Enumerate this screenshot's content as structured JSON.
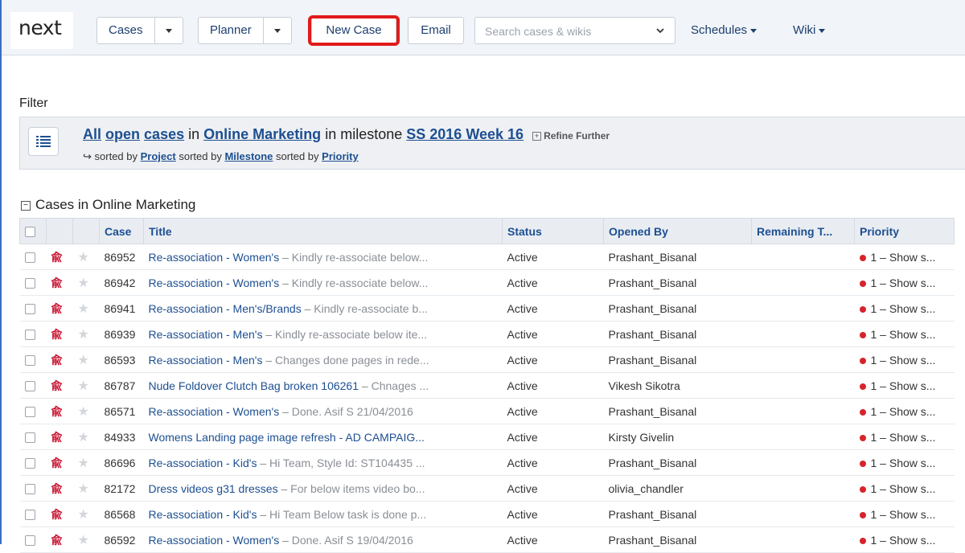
{
  "nav": {
    "logo": "next",
    "cases_label": "Cases",
    "planner_label": "Planner",
    "new_case_label": "New Case",
    "email_label": "Email",
    "search_placeholder": "Search cases & wikis",
    "schedules_label": "Schedules",
    "wiki_label": "Wiki",
    "highlight_color": "#e01b1b"
  },
  "filter": {
    "label": "Filter",
    "all": "All",
    "open": "open",
    "cases": "cases",
    "in1": "in",
    "project": "Online Marketing",
    "in_milestone": "in milestone",
    "milestone": "SS 2016 Week 16",
    "refine": "Refine Further",
    "sorted_arrow": "↪",
    "sorted_by_1": "sorted by",
    "sort1": "Project",
    "sorted_by_2": "sorted by",
    "sort2": "Milestone",
    "sorted_by_3": "sorted by",
    "sort3": "Priority"
  },
  "group": {
    "title": "Cases in Online Marketing"
  },
  "table": {
    "headers": {
      "case": "Case",
      "title": "Title",
      "status": "Status",
      "opened_by": "Opened By",
      "remaining": "Remaining T...",
      "priority": "Priority"
    },
    "rows": [
      {
        "case": "86952",
        "title": "Re-association - Women's",
        "excerpt": "Kindly re-associate below...",
        "status": "Active",
        "opened_by": "Prashant_Bisanal",
        "priority": "1 – Show s..."
      },
      {
        "case": "86942",
        "title": "Re-association - Women's",
        "excerpt": "Kindly re-associate below...",
        "status": "Active",
        "opened_by": "Prashant_Bisanal",
        "priority": "1 – Show s..."
      },
      {
        "case": "86941",
        "title": "Re-association - Men's/Brands",
        "excerpt": "Kindly re-associate b...",
        "status": "Active",
        "opened_by": "Prashant_Bisanal",
        "priority": "1 – Show s..."
      },
      {
        "case": "86939",
        "title": "Re-association - Men's",
        "excerpt": "Kindly re-associate below ite...",
        "status": "Active",
        "opened_by": "Prashant_Bisanal",
        "priority": "1 – Show s..."
      },
      {
        "case": "86593",
        "title": "Re-association - Men's",
        "excerpt": "Changes done pages in rede...",
        "status": "Active",
        "opened_by": "Prashant_Bisanal",
        "priority": "1 – Show s..."
      },
      {
        "case": "86787",
        "title": "Nude Foldover Clutch Bag broken 106261",
        "excerpt": "Chnages ...",
        "status": "Active",
        "opened_by": "Vikesh Sikotra",
        "priority": "1 – Show s..."
      },
      {
        "case": "86571",
        "title": "Re-association - Women's",
        "excerpt": "Done. Asif S 21/04/2016",
        "status": "Active",
        "opened_by": "Prashant_Bisanal",
        "priority": "1 – Show s..."
      },
      {
        "case": "84933",
        "title": "Womens Landing page image refresh - AD CAMPAIG...",
        "excerpt": "",
        "status": "Active",
        "opened_by": "Kirsty Givelin",
        "priority": "1 – Show s..."
      },
      {
        "case": "86696",
        "title": "Re-association - Kid's",
        "excerpt": "Hi Team, Style Id: ST104435 ...",
        "status": "Active",
        "opened_by": "Prashant_Bisanal",
        "priority": "1 – Show s..."
      },
      {
        "case": "82172",
        "title": "Dress videos g31 dresses",
        "excerpt": "For below items video bo...",
        "status": "Active",
        "opened_by": "olivia_chandler",
        "priority": "1 – Show s..."
      },
      {
        "case": "86568",
        "title": "Re-association - Kid's",
        "excerpt": "Hi Team Below task is done p...",
        "status": "Active",
        "opened_by": "Prashant_Bisanal",
        "priority": "1 – Show s..."
      },
      {
        "case": "86592",
        "title": "Re-association - Women's",
        "excerpt": "Done. Asif S 19/04/2016",
        "status": "Active",
        "opened_by": "Prashant_Bisanal",
        "priority": "1 – Show s..."
      }
    ],
    "separator": "–",
    "bug_glyph": "兪",
    "star_glyph": "★",
    "priority_color": "#d6242a"
  }
}
